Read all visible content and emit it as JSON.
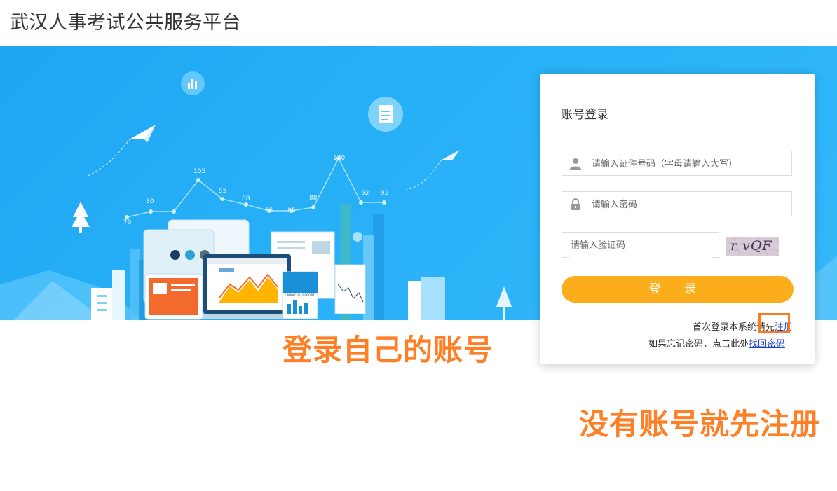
{
  "header": {
    "site_title": "武汉人事考试公共服务平台"
  },
  "banner": {
    "chart_labels": [
      "70",
      "80",
      "80",
      "105",
      "95",
      "88",
      "85",
      "85",
      "88",
      "120",
      "92",
      "92"
    ],
    "report_label": "FINANCIAL REPORT"
  },
  "login": {
    "title": "账号登录",
    "id_placeholder": "请输入证件号码（字母请输入大写）",
    "password_placeholder": "请输入密码",
    "captcha_placeholder": "请输入验证码",
    "captcha_text": "r vQF",
    "login_button": "登 录",
    "register_prefix": "首次登录本系统请先",
    "register_link": "注册",
    "forgot_prefix": "如果忘记密码，点击此处",
    "forgot_link": "找回密码"
  },
  "annotations": {
    "login_hint": "登录自己的账号",
    "register_hint": "没有账号就先注册"
  },
  "colors": {
    "banner": "#28b0f7",
    "button": "#fbad1c",
    "annotation": "#ff7f27",
    "link": "#1a3fcc"
  }
}
